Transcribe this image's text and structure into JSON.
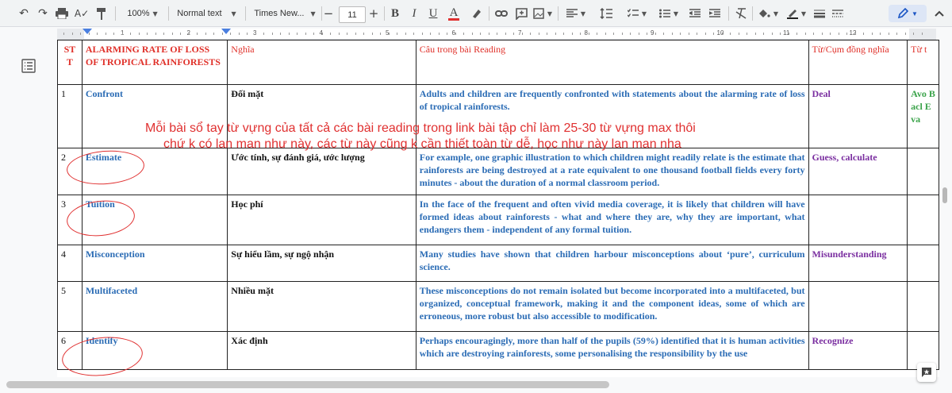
{
  "toolbar": {
    "zoom": "100%",
    "style": "Normal text",
    "font": "Times New...",
    "font_size": "11",
    "minus": "−",
    "plus": "+",
    "bold": "B",
    "italic": "I",
    "underline": "U",
    "text_color": "A"
  },
  "ruler": {
    "numbers": [
      "1",
      "2",
      "3",
      "4",
      "5",
      "6",
      "7",
      "8",
      "9",
      "10",
      "11",
      "12"
    ]
  },
  "table": {
    "headers": [
      "ST T",
      "ALARMING RATE OF LOSS OF TROPICAL RAINFORESTS",
      "Nghĩa",
      "Câu trong bài Reading",
      "Từ/Cụm đồng nghĩa",
      "Từ t"
    ],
    "rows": [
      {
        "num": "1",
        "word": "Confront",
        "meaning": "Đối mặt",
        "sentence": "Adults and children are frequently confronted with statements about the alarming rate of loss of tropical rainforests.",
        "synonym": "Deal",
        "antonym": "Avo Bacl Eva"
      },
      {
        "num": "2",
        "word": "Estimate",
        "meaning": "Ước tính, sự đánh giá, ước lượng",
        "sentence": "For example, one graphic illustration to which children might readily relate is the estimate that rainforests are being destroyed at a rate equivalent to one thousand football fields every forty minutes - about the duration of a normal classroom period.",
        "synonym": "Guess, calculate",
        "antonym": ""
      },
      {
        "num": "3",
        "word": "Tuition",
        "meaning": "Học phí",
        "sentence": "In the face of the frequent and often vivid media coverage, it is likely that children will have formed ideas about rainforests - what and where they are, why they are important, what endangers them - independent of any formal tuition.",
        "synonym": "",
        "antonym": ""
      },
      {
        "num": "4",
        "word": "Misconception",
        "meaning": "Sự hiểu lầm, sự ngộ nhận",
        "sentence": "Many studies have shown that children harbour misconceptions about ‘pure’, curriculum science.",
        "synonym": "Misunderstanding",
        "antonym": ""
      },
      {
        "num": "5",
        "word": "Multifaceted",
        "meaning": "Nhiều mặt",
        "sentence": "These misconceptions do not remain isolated but become incorporated into a multifaceted, but organized, conceptual framework, making it and the component ideas, some of which are erroneous, more robust but also accessible to modification.",
        "synonym": "",
        "antonym": ""
      },
      {
        "num": "6",
        "word": "Identify",
        "meaning": "Xác định",
        "sentence": "Perhaps encouragingly, more than half of the pupils (59%) identified that it is human activities which are destroying rainforests, some personalising the responsibility by the use",
        "synonym": "Recognize",
        "antonym": ""
      }
    ]
  },
  "comment": {
    "line1": "Mỗi bài sổ tay từ vựng của tất cả các bài reading trong link bài tập chỉ làm 25-30 từ vựng max thôi",
    "line2": "chứ k có lan man như này, các từ này cũng k cần thiết toàn từ dễ, học như này lan man nha"
  },
  "colors": {
    "header": "#e0312a",
    "word": "#2b6cb5",
    "synonym": "#7a2ea0",
    "antonym": "#3aa34a",
    "annotation": "#e03030"
  },
  "icons": [
    "undo-icon",
    "redo-icon",
    "print-icon",
    "spellcheck-icon",
    "paint-format-icon",
    "link-icon",
    "comment-icon",
    "image-icon",
    "align-icon",
    "line-spacing-icon",
    "checklist-icon",
    "bullet-list-icon",
    "numbered-list-icon",
    "indent-icon",
    "clear-format-icon",
    "pen-icon",
    "outline-icon",
    "feedback-icon"
  ]
}
